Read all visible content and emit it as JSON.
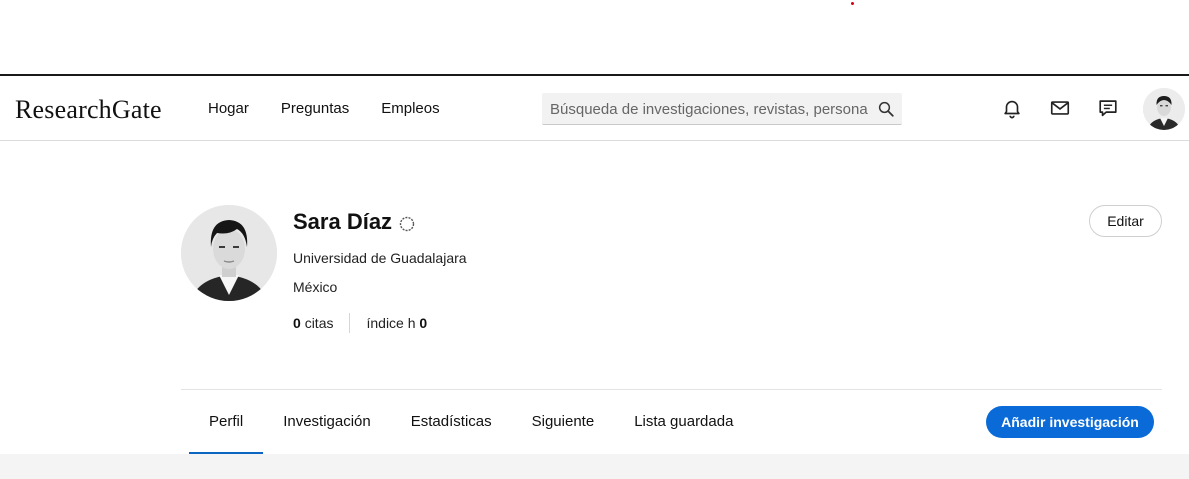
{
  "header": {
    "logo": "ResearchGate",
    "nav": [
      {
        "label": "Hogar"
      },
      {
        "label": "Preguntas"
      },
      {
        "label": "Empleos"
      }
    ],
    "search": {
      "placeholder": "Búsqueda de investigaciones, revistas, personas, etc.",
      "value": ""
    },
    "icons": [
      "bell-icon",
      "mail-icon",
      "chat-icon",
      "avatar"
    ]
  },
  "profile": {
    "name": "Sara Díaz",
    "institution": "Universidad de Guadalajara",
    "country": "México",
    "stats": {
      "citations_value": "0",
      "citations_label": "citas",
      "hindex_label": "índice h",
      "hindex_value": "0"
    },
    "edit_label": "Editar"
  },
  "tabs": [
    {
      "label": "Perfil",
      "active": true
    },
    {
      "label": "Investigación",
      "active": false
    },
    {
      "label": "Estadísticas",
      "active": false
    },
    {
      "label": "Siguiente",
      "active": false
    },
    {
      "label": "Lista guardada",
      "active": false
    }
  ],
  "actions": {
    "add_research_label": "Añadir investigación"
  },
  "colors": {
    "accent": "#0a6ad7",
    "tab_underline": "#0a66c2",
    "status_dot": "#d0021b"
  }
}
